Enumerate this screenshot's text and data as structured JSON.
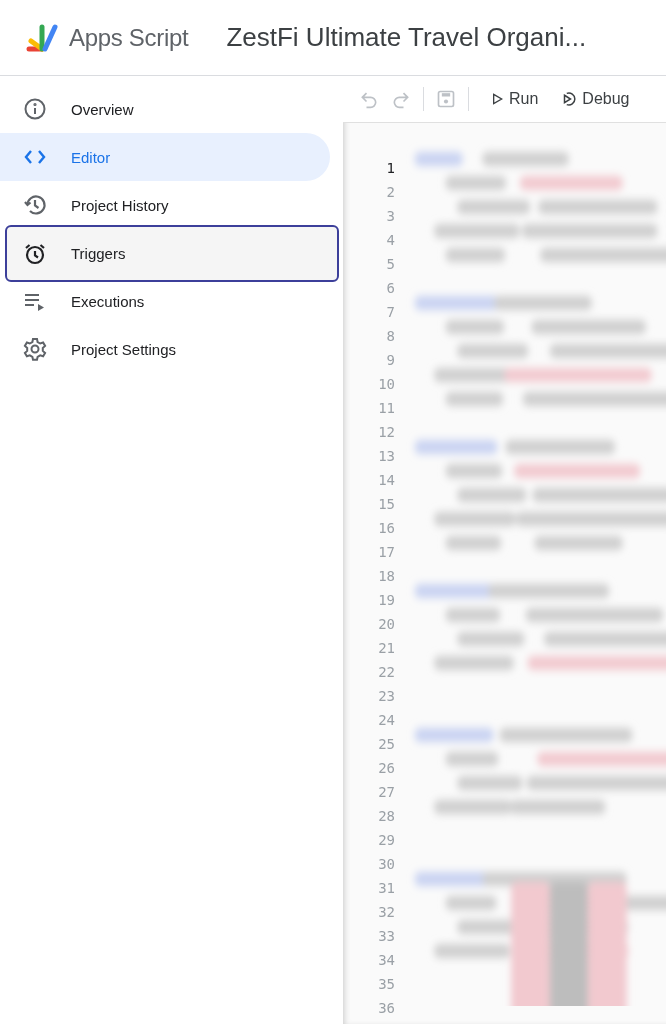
{
  "header": {
    "product": "Apps Script",
    "project_title": "ZestFi Ultimate Travel Organi..."
  },
  "nav": [
    {
      "kind": "info",
      "label": "Overview",
      "selected": false,
      "focused": false
    },
    {
      "kind": "code",
      "label": "Editor",
      "selected": true,
      "focused": false
    },
    {
      "kind": "history",
      "label": "Project History",
      "selected": false,
      "focused": false
    },
    {
      "kind": "alarm",
      "label": "Triggers",
      "selected": false,
      "focused": true
    },
    {
      "kind": "list",
      "label": "Executions",
      "selected": false,
      "focused": false
    },
    {
      "kind": "gear",
      "label": "Project Settings",
      "selected": false,
      "focused": false
    }
  ],
  "toolbar": {
    "undo_disabled": true,
    "redo_disabled": true,
    "save_disabled": true,
    "run": "Run",
    "debug": "Debug"
  },
  "editor": {
    "lines": [
      {
        "number": "1",
        "current": true
      },
      {
        "number": "2",
        "current": false
      },
      {
        "number": "3",
        "current": false
      },
      {
        "number": "4",
        "current": false
      },
      {
        "number": "5",
        "current": false
      },
      {
        "number": "6",
        "current": false
      },
      {
        "number": "7",
        "current": false
      },
      {
        "number": "8",
        "current": false
      },
      {
        "number": "9",
        "current": false
      },
      {
        "number": "10",
        "current": false
      },
      {
        "number": "11",
        "current": false
      },
      {
        "number": "12",
        "current": false
      },
      {
        "number": "13",
        "current": false
      },
      {
        "number": "14",
        "current": false
      },
      {
        "number": "15",
        "current": false
      },
      {
        "number": "16",
        "current": false
      },
      {
        "number": "17",
        "current": false
      },
      {
        "number": "18",
        "current": false
      },
      {
        "number": "19",
        "current": false
      },
      {
        "number": "20",
        "current": false
      },
      {
        "number": "21",
        "current": false
      },
      {
        "number": "22",
        "current": false
      },
      {
        "number": "23",
        "current": false
      },
      {
        "number": "24",
        "current": false
      },
      {
        "number": "25",
        "current": false
      },
      {
        "number": "26",
        "current": false
      },
      {
        "number": "27",
        "current": false
      },
      {
        "number": "28",
        "current": false
      },
      {
        "number": "29",
        "current": false
      },
      {
        "number": "30",
        "current": false
      },
      {
        "number": "31",
        "current": false
      },
      {
        "number": "32",
        "current": false
      },
      {
        "number": "33",
        "current": false
      },
      {
        "number": "34",
        "current": false
      },
      {
        "number": "35",
        "current": false
      },
      {
        "number": "36",
        "current": false
      }
    ]
  }
}
